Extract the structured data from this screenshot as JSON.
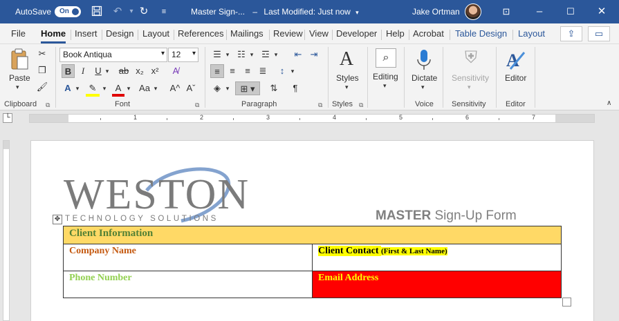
{
  "titlebar": {
    "autosave_label": "AutoSave",
    "autosave_state": "On",
    "doc_title": "Master Sign-...",
    "modified": "Last Modified: Just now",
    "user": "Jake Ortman",
    "icons": [
      "save-icon",
      "undo-icon",
      "redo-icon",
      "customize-icon",
      "ribbon-display-icon",
      "minimize-icon",
      "maximize-icon",
      "close-icon"
    ]
  },
  "menu": {
    "tabs": [
      "File",
      "Home",
      "Insert",
      "Design",
      "Layout",
      "References",
      "Mailings",
      "Review",
      "View",
      "Developer",
      "Help",
      "Acrobat",
      "Table Design",
      "Layout"
    ],
    "active": "Home"
  },
  "ribbon": {
    "clipboard": {
      "paste_label": "Paste",
      "group_label": "Clipboard"
    },
    "font": {
      "font_name": "Book Antiqua",
      "font_size": "12",
      "group_label": "Font",
      "bold": "B",
      "italic": "I",
      "underline": "U",
      "strike": "ab",
      "subscript": "x₂",
      "superscript": "x²",
      "change_case": "Aa",
      "grow": "A^",
      "shrink": "Aˇ"
    },
    "paragraph": {
      "group_label": "Paragraph"
    },
    "styles": {
      "label": "Styles",
      "group_label": "Styles"
    },
    "editing": {
      "label": "Editing"
    },
    "voice": {
      "label": "Dictate",
      "group_label": "Voice"
    },
    "sensitivity": {
      "label": "Sensitivity",
      "group_label": "Sensitivity"
    },
    "editor": {
      "label": "Editor",
      "group_label": "Editor"
    }
  },
  "ruler": {
    "numbers": [
      "1",
      "2",
      "3",
      "4",
      "5",
      "6",
      "7"
    ]
  },
  "document": {
    "logo_main": "WESTON",
    "logo_sub": "TECHNOLOGY SOLUTIONS",
    "form_title_bold": "MASTER",
    "form_title_rest": " Sign-Up Form",
    "table": {
      "header": "Client Information",
      "company": "Company Name",
      "contact": "Client Contact",
      "contact_note": "(First & Last Name)",
      "phone": "Phone Number",
      "email": "Email Address"
    }
  },
  "colors": {
    "word_blue": "#2b579a",
    "header_fill": "#ffd966",
    "email_fill": "#ff0000"
  }
}
